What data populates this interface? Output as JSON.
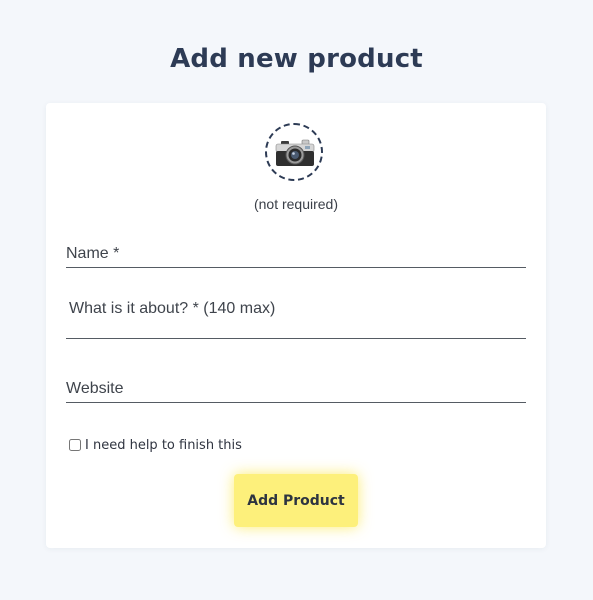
{
  "page": {
    "title": "Add new product"
  },
  "form": {
    "photo": {
      "icon": "camera-icon",
      "note": "(not required)"
    },
    "name": {
      "placeholder": "Name *",
      "value": ""
    },
    "about": {
      "placeholder": "What is it about? * (140 max)",
      "value": ""
    },
    "website": {
      "placeholder": "Website",
      "value": ""
    },
    "help_checkbox": {
      "label": "I need help to finish this",
      "checked": false
    },
    "submit_label": "Add Product"
  },
  "colors": {
    "background": "#f4f7fb",
    "title": "#2d3b55",
    "button": "#fdf07b",
    "card": "#ffffff"
  }
}
